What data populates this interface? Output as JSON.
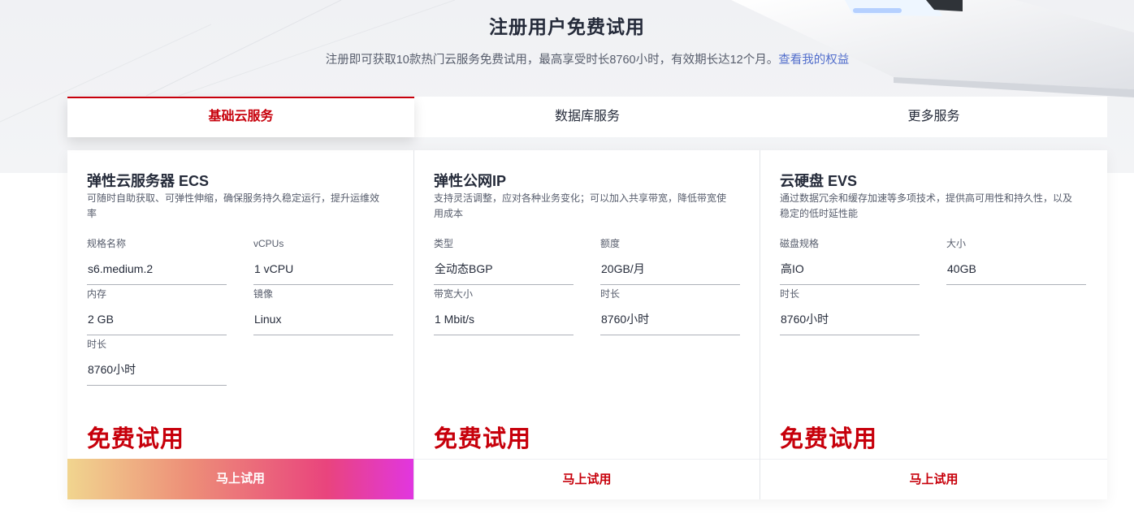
{
  "header": {
    "title": "注册用户免费试用",
    "subtitle": "注册即可获取10款热门云服务免费试用，最高享受时长8760小时，有效期长达12个月。",
    "link": "查看我的权益"
  },
  "tabs": [
    {
      "label": "基础云服务",
      "active": true
    },
    {
      "label": "数据库服务",
      "active": false
    },
    {
      "label": "更多服务",
      "active": false
    }
  ],
  "cards": [
    {
      "title": "弹性云服务器 ECS",
      "desc": "可随时自助获取、可弹性伸缩，确保服务持久稳定运行，提升运维效率",
      "specs": [
        {
          "label": "规格名称",
          "value": "s6.medium.2"
        },
        {
          "label": "vCPUs",
          "value": "1 vCPU"
        },
        {
          "label": "内存",
          "value": "2 GB"
        },
        {
          "label": "镜像",
          "value": "Linux"
        },
        {
          "label": "时长",
          "value": "8760小时"
        }
      ],
      "free_label": "免费试用",
      "button": "马上试用"
    },
    {
      "title": "弹性公网IP",
      "desc": "支持灵活调整，应对各种业务变化；可以加入共享带宽，降低带宽使用成本",
      "specs": [
        {
          "label": "类型",
          "value": "全动态BGP"
        },
        {
          "label": "额度",
          "value": "20GB/月"
        },
        {
          "label": "带宽大小",
          "value": "1 Mbit/s"
        },
        {
          "label": "时长",
          "value": "8760小时"
        }
      ],
      "free_label": "免费试用",
      "button": "马上试用"
    },
    {
      "title": "云硬盘 EVS",
      "desc": "通过数据冗余和缓存加速等多项技术，提供高可用性和持久性，以及稳定的低时延性能",
      "specs": [
        {
          "label": "磁盘规格",
          "value": "高IO"
        },
        {
          "label": "大小",
          "value": "40GB"
        },
        {
          "label": "时长",
          "value": "8760小时"
        }
      ],
      "free_label": "免费试用",
      "button": "马上试用"
    }
  ],
  "colors": {
    "accent": "#c7000b",
    "link": "#526ecc",
    "text": "#252b3a",
    "muted": "#575d6c"
  }
}
